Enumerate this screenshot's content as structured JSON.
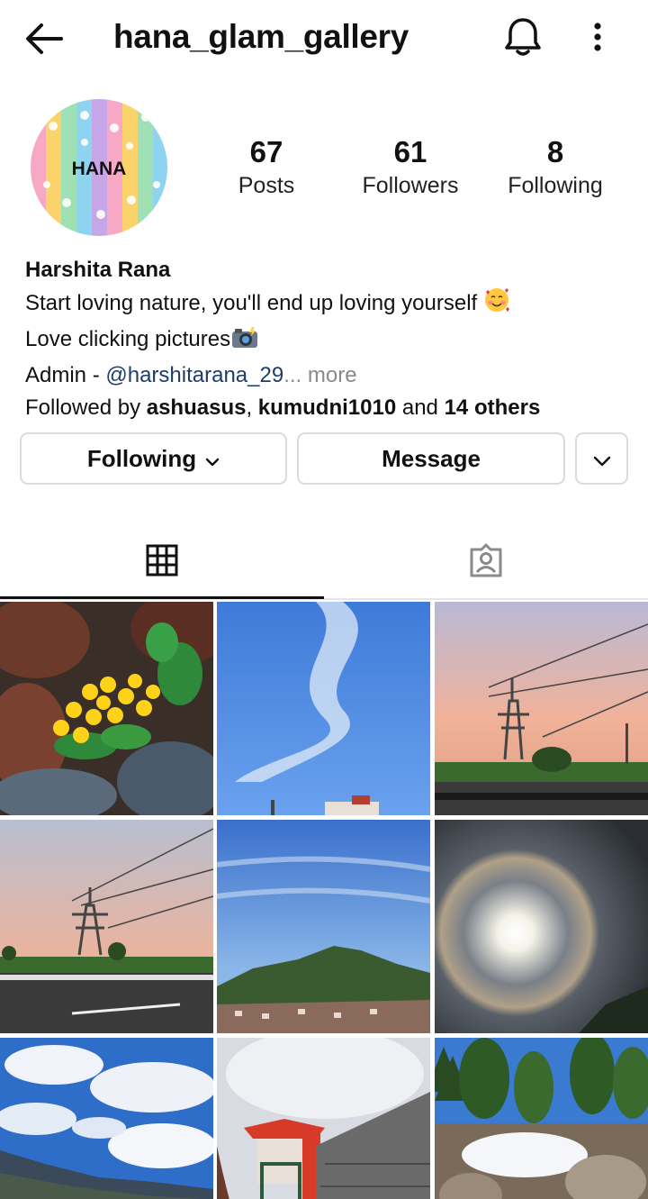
{
  "header": {
    "username": "hana_glam_gallery",
    "back_icon": "arrow-left-icon",
    "bell_icon": "bell-icon",
    "menu_icon": "more-vertical-icon"
  },
  "avatar": {
    "text": "HANA"
  },
  "stats": {
    "posts": {
      "value": "67",
      "label": "Posts"
    },
    "followers": {
      "value": "61",
      "label": "Followers"
    },
    "following": {
      "value": "8",
      "label": "Following"
    }
  },
  "bio": {
    "name": "Harshita Rana",
    "line1": "Start loving nature, you'll end up loving yourself",
    "line2": "Love clicking pictures",
    "admin_prefix": "Admin - ",
    "admin_handle": "@harshitarana_29",
    "ellipsis": "...",
    "more": " more",
    "followed_prefix": "Followed by ",
    "followed_user1": "ashuasus",
    "followed_sep": ", ",
    "followed_user2": "kumudni1010",
    "followed_and": " and ",
    "followed_others": "14 others"
  },
  "actions": {
    "following_label": "Following",
    "message_label": "Message"
  },
  "tabs": [
    {
      "name": "posts-grid",
      "icon": "grid-icon",
      "active": true
    },
    {
      "name": "tagged",
      "icon": "tagged-person-icon",
      "active": false
    }
  ],
  "posts": [
    {
      "subject": "yellow primrose flowers on rocks"
    },
    {
      "subject": "blue sky with streak of clouds"
    },
    {
      "subject": "power tower at sunset"
    },
    {
      "subject": "power tower over highway"
    },
    {
      "subject": "hill under blue sky"
    },
    {
      "subject": "sun halo"
    },
    {
      "subject": "clouds over mountains"
    },
    {
      "subject": "red roofed house and stone wall"
    },
    {
      "subject": "snow on rocks under trees"
    }
  ],
  "colors": {
    "link": "#1e3d6b",
    "muted": "#8a8a8a",
    "border": "#dbdbdb"
  }
}
